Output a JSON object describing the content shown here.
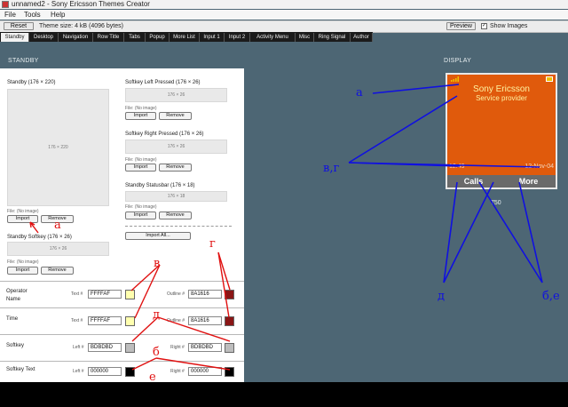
{
  "window": {
    "title": "unnamed2 - Sony Ericsson Themes Creator"
  },
  "menu": [
    "File",
    "Tools",
    "Help"
  ],
  "toolbar": {
    "reset_label": "Reset",
    "theme_size": "Theme size: 4 kB (4096 bytes)",
    "preview_label": "Preview",
    "show_images_label": "Show Images",
    "show_images_checked": true
  },
  "tabs": [
    "Standby",
    "Desktop",
    "Navigation",
    "Row Title",
    "Tabs",
    "Popup",
    "More List",
    "Input 1",
    "Input 2",
    "Activity Menu",
    "Misc",
    "Ring Signal",
    "Author"
  ],
  "sections": {
    "left": "STANDBY",
    "right": "DISPLAY"
  },
  "images": {
    "standby": {
      "label": "Standby (176 × 220)",
      "size": "176 × 220",
      "file": "File: (No image)"
    },
    "softkey_left_pressed": {
      "label": "Softkey Left Pressed (176 × 26)",
      "size": "176 × 26",
      "file": "File: (No image)"
    },
    "softkey_right_pressed": {
      "label": "Softkey Right Pressed (176 × 26)",
      "size": "176 × 26",
      "file": "File: (No image)"
    },
    "standby_statusbar": {
      "label": "Standby Statusbar (176 × 18)",
      "size": "176 × 18",
      "file": "File: (No image)"
    },
    "standby_softkey": {
      "label": "Standby Softkey (176 × 26)",
      "size": "176 × 26",
      "file": "File: (No image)"
    }
  },
  "buttons": {
    "import": "Import",
    "remove": "Remove",
    "import_all": "Import All..."
  },
  "color_rows": {
    "operator_name": {
      "label": "Operator Name",
      "a_label": "Text #",
      "a_value": "FFFFAF",
      "a_color": "#FFFFAF",
      "b_label": "Outline #",
      "b_value": "8A1616",
      "b_color": "#8A1616"
    },
    "time": {
      "label": "Time",
      "a_label": "Text #",
      "a_value": "FFFFAF",
      "a_color": "#FFFFAF",
      "b_label": "Outline #",
      "b_value": "8A1616",
      "b_color": "#8A1616"
    },
    "softkey": {
      "label": "Softkey",
      "a_label": "Left #",
      "a_value": "BDBDBD",
      "a_color": "#BDBDBD",
      "b_label": "Right #",
      "b_value": "BDBDBD",
      "b_color": "#BDBDBD"
    },
    "softkey_text": {
      "label": "Softkey Text",
      "a_label": "Left #",
      "a_value": "000000",
      "a_color": "#000000",
      "b_label": "Right #",
      "b_value": "000000",
      "b_color": "#000000"
    }
  },
  "phone": {
    "operator": "Sony Ericsson",
    "provider": "Service provider",
    "time": "12:49",
    "date": "12-Nov-04",
    "soft_left": "Calls",
    "soft_right": "More",
    "below_label": "750",
    "screen_color": "#E05A0C"
  },
  "annotations": {
    "a": "а",
    "b": "б",
    "v": "в",
    "g": "г",
    "d": "д",
    "vg": "в,г",
    "be": "б,е",
    "e": "е"
  }
}
